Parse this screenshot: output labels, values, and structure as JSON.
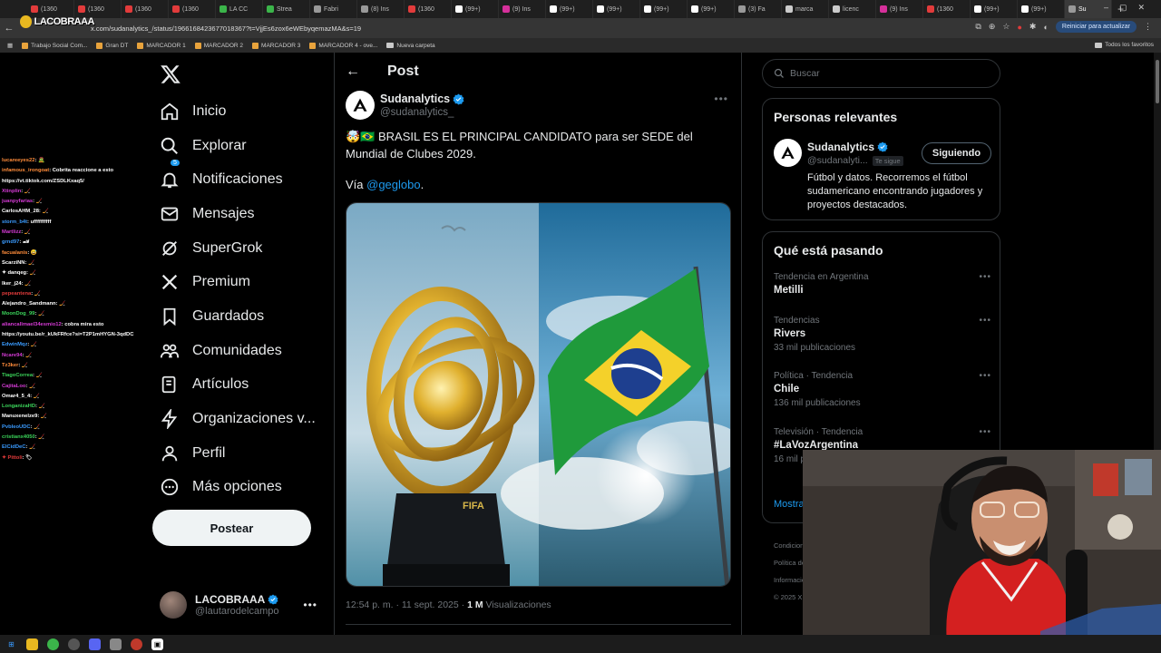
{
  "browser": {
    "tabs": [
      {
        "label": "(1360",
        "color": "#e23b3b"
      },
      {
        "label": "(1360",
        "color": "#e23b3b"
      },
      {
        "label": "(1360",
        "color": "#e23b3b"
      },
      {
        "label": "(1360",
        "color": "#e23b3b"
      },
      {
        "label": "LA CC",
        "color": "#3bb54a"
      },
      {
        "label": "Strea",
        "color": "#3bb54a"
      },
      {
        "label": "Fabri",
        "color": "#999999"
      },
      {
        "label": "(8) Ins",
        "color": "#999999"
      },
      {
        "label": "(1360",
        "color": "#e23b3b"
      },
      {
        "label": "(99+)",
        "color": "#ffffff"
      },
      {
        "label": "(9) Ins",
        "color": "#d6309b"
      },
      {
        "label": "(99+)",
        "color": "#ffffff"
      },
      {
        "label": "(99+)",
        "color": "#ffffff"
      },
      {
        "label": "(99+)",
        "color": "#ffffff"
      },
      {
        "label": "(99+)",
        "color": "#ffffff"
      },
      {
        "label": "(3) Fa",
        "color": "#999999"
      },
      {
        "label": "marca",
        "color": "#cccccc"
      },
      {
        "label": "licenc",
        "color": "#cccccc"
      },
      {
        "label": "(9) Ins",
        "color": "#d6309b"
      },
      {
        "label": "(1360",
        "color": "#e23b3b"
      },
      {
        "label": "(99+)",
        "color": "#ffffff"
      },
      {
        "label": "(99+)",
        "color": "#ffffff"
      },
      {
        "label": "Su",
        "color": "#999999",
        "active": true
      }
    ],
    "url": "x.com/sudanalytics_/status/1966168423677018367?t=VjjEs6zox6eWEbyqemazMA&s=19",
    "update_button": "Reiniciar para actualizar",
    "bookmarks": [
      {
        "label": "Trabajo Social Com...",
        "kind": "site"
      },
      {
        "label": "Gran DT",
        "kind": "site"
      },
      {
        "label": "MARCADOR 1",
        "kind": "site"
      },
      {
        "label": "MARCADOR 2",
        "kind": "site"
      },
      {
        "label": "MARCADOR 3",
        "kind": "site"
      },
      {
        "label": "MARCADOR 4 - ove...",
        "kind": "site"
      },
      {
        "label": "Nueva carpeta",
        "kind": "folder"
      }
    ],
    "all_bookmarks": "Todos los favoritos"
  },
  "stream": {
    "logo_text": "LACOBRAAA",
    "chat": [
      {
        "user": "lucareeyes22",
        "msg": ": 🧟",
        "color": "#ff8c3a"
      },
      {
        "user": "infamous_irongoat",
        "msg": ": Cobrita reaccione a esto",
        "color": "#ff8c3a"
      },
      {
        "user": "",
        "msg": "https://vt.tiktok.com/ZSDLKxaq5/",
        "color": "#ffffff"
      },
      {
        "user": "Xtinplin",
        "msg": ": 🏒",
        "color": "#d43ad4"
      },
      {
        "user": "juanpyfarias",
        "msg": ": 🏒",
        "color": "#d43ad4"
      },
      {
        "user": "CarlosAHM_28",
        "msg": ": 🏒",
        "color": "#ffffff"
      },
      {
        "user": "storm_b4t",
        "msg": ": uffffffffff",
        "color": "#3a9bff"
      },
      {
        "user": "Martlizz",
        "msg": ": 🏒",
        "color": "#d43ad4"
      },
      {
        "user": "grnd97",
        "msg": ": 🏎",
        "color": "#3a9bff"
      },
      {
        "user": "facualanis",
        "msg": ": 😅",
        "color": "#ff8c3a"
      },
      {
        "user": "ScarziNN",
        "msg": ": 🏒",
        "color": "#ffffff"
      },
      {
        "user": "✦ danqeg",
        "msg": ": 🏒",
        "color": "#ffffff"
      },
      {
        "user": "Iker_j24",
        "msg": ": 🏒",
        "color": "#ffffff"
      },
      {
        "user": "pepeantena",
        "msg": ": 🏒",
        "color": "#e23b3b"
      },
      {
        "user": "Alejandro_Sandmann",
        "msg": ": 🏒",
        "color": "#ffffff"
      },
      {
        "user": "MoonDog_99",
        "msg": ": 🏒",
        "color": "#3bd45a"
      },
      {
        "user": "aliancallmael34esmio12",
        "msg": ": cobra mira esto",
        "color": "#d43ad4"
      },
      {
        "user": "",
        "msg": "https://youtu.be/r_kUkFRfce?si=T2P1mHYGN-3qdDC",
        "color": "#ffffff"
      },
      {
        "user": "EdwinMqz",
        "msg": ": 🏒",
        "color": "#3a9bff"
      },
      {
        "user": "Ncare94",
        "msg": ": 🏒",
        "color": "#d43ad4"
      },
      {
        "user": "Tz3ker",
        "msg": ": 🏒",
        "color": "#ff8c3a"
      },
      {
        "user": "TiagoCorrea",
        "msg": ": 🏒",
        "color": "#3bd45a"
      },
      {
        "user": "CajitaLoo",
        "msg": ": 🏒",
        "color": "#d43ad4"
      },
      {
        "user": "Omar4_5_4",
        "msg": ": 🏒",
        "color": "#ffffff"
      },
      {
        "user": "LonganizaHD",
        "msg": ": 🏒",
        "color": "#3bd45a"
      },
      {
        "user": "Manuxenelze9",
        "msg": ": 🏒",
        "color": "#ffffff"
      },
      {
        "user": "PvbleoUDC",
        "msg": ": 🏒",
        "color": "#3a9bff"
      },
      {
        "user": "cristianx4050",
        "msg": ": 🏒",
        "color": "#3bd45a"
      },
      {
        "user": "ElCidDeC",
        "msg": ": 🏒",
        "color": "#3a9bff"
      },
      {
        "user": "✦ Pittoli",
        "msg": ": 🏷",
        "color": "#e23b3b"
      }
    ]
  },
  "nav": {
    "items": [
      {
        "label": "Inicio",
        "icon": "home-icon"
      },
      {
        "label": "Explorar",
        "icon": "search-icon"
      },
      {
        "label": "Notificaciones",
        "icon": "bell-icon",
        "badge": "5"
      },
      {
        "label": "Mensajes",
        "icon": "envelope-icon"
      },
      {
        "label": "SuperGrok",
        "icon": "grok-icon"
      },
      {
        "label": "Premium",
        "icon": "x-icon"
      },
      {
        "label": "Guardados",
        "icon": "bookmark-icon"
      },
      {
        "label": "Comunidades",
        "icon": "people-icon"
      },
      {
        "label": "Artículos",
        "icon": "article-icon"
      },
      {
        "label": "Organizaciones v...",
        "icon": "lightning-icon"
      },
      {
        "label": "Perfil",
        "icon": "user-icon"
      },
      {
        "label": "Más opciones",
        "icon": "more-circle-icon"
      }
    ],
    "post_button": "Postear",
    "account": {
      "name": "LACOBRAAA",
      "handle": "@lautarodelcampo"
    }
  },
  "post": {
    "header_title": "Post",
    "author_name": "Sudanalytics",
    "author_handle": "@sudanalytics_",
    "text": "🤯🇧🇷 BRASIL ES EL PRINCIPAL CANDIDATO para ser SEDE del Mundial de Clubes 2029.",
    "via_prefix": "Vía ",
    "via_link": "@geglobo",
    "via_suffix": ".",
    "trophy_text": "FIFA",
    "timestamp": "12:54 p. m. · 11 sept. 2025 · ",
    "views_count": "1 M",
    "views_label": " Visualizaciones"
  },
  "sidebar": {
    "search_placeholder": "Buscar",
    "relevant_title": "Personas relevantes",
    "relevant_person": {
      "name": "Sudanalytics",
      "handle": "@sudanalyti...",
      "follows_you": "Te sigue",
      "following_button": "Siguiendo",
      "bio": "Fútbol y datos. Recorremos el fútbol sudamericano encontrando jugadores y proyectos destacados."
    },
    "trending_title": "Qué está pasando",
    "trends": [
      {
        "context": "Tendencia en Argentina",
        "name": "Metilli",
        "count": ""
      },
      {
        "context": "Tendencias",
        "name": "Rivers",
        "count": "33 mil publicaciones"
      },
      {
        "context": "Política · Tendencia",
        "name": "Chile",
        "count": "136 mil publicaciones"
      },
      {
        "context": "Televisión · Tendencia",
        "name": "#LaVozArgentina",
        "count": "16 mil publicaciones"
      }
    ],
    "show_more": "Mostrar más",
    "footer_links": [
      "Condiciones de Servicio",
      "Política de Privacidad",
      "Información de anuncios",
      "© 2025 X Corp."
    ]
  },
  "colors": {
    "accent": "#1d9bf0",
    "background": "#000000",
    "border": "#2f3336",
    "muted_text": "#71767b"
  }
}
